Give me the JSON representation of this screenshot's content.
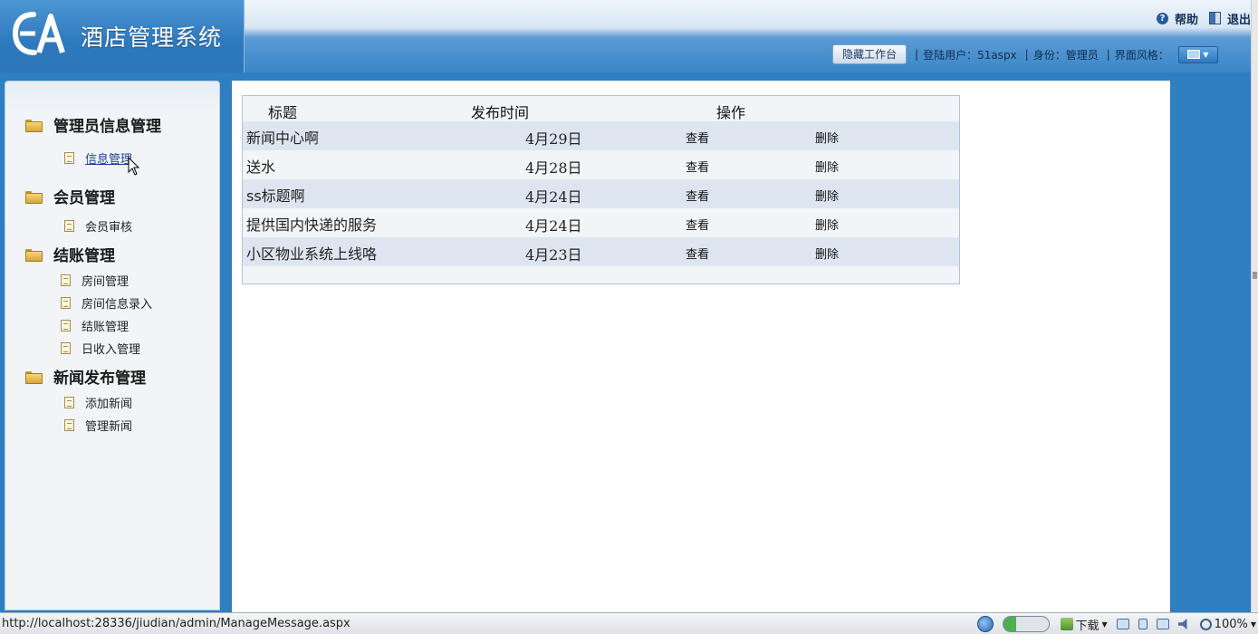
{
  "app": {
    "logo_text": "EA",
    "title": "酒店管理系统"
  },
  "header": {
    "help_label": "帮助",
    "logout_label": "退出",
    "hide_desktop_label": "隐藏工作台",
    "login_user": "登陆用户：51aspx",
    "identity": "身份：管理员",
    "ui_style": "界面风格：",
    "separator": "|"
  },
  "sidebar": {
    "groups": [
      {
        "label": "管理员信息管理",
        "items": [
          {
            "label": "信息管理",
            "active": true
          }
        ]
      },
      {
        "label": "会员管理",
        "items": [
          {
            "label": "会员审核"
          }
        ]
      },
      {
        "label": "结账管理",
        "items": [
          {
            "label": "房间管理"
          },
          {
            "label": "房间信息录入"
          },
          {
            "label": "结账管理"
          },
          {
            "label": "日收入管理"
          }
        ]
      },
      {
        "label": "新闻发布管理",
        "items": [
          {
            "label": "添加新闻"
          },
          {
            "label": "管理新闻"
          }
        ]
      }
    ]
  },
  "table": {
    "headers": {
      "title": "标题",
      "time": "发布时间",
      "action": "操作"
    },
    "rows": [
      {
        "title": "新闻中心啊",
        "date": "4月29日",
        "view": "查看",
        "delete": "删除"
      },
      {
        "title": "送水",
        "date": "4月28日",
        "view": "查看",
        "delete": "删除"
      },
      {
        "title": "ss标题啊",
        "date": "4月24日",
        "view": "查看",
        "delete": "删除"
      },
      {
        "title": "提供国内快递的服务",
        "date": "4月24日",
        "view": "查看",
        "delete": "删除"
      },
      {
        "title": "小区物业系统上线咯",
        "date": "4月23日",
        "view": "查看",
        "delete": "删除"
      }
    ]
  },
  "browser": {
    "status_url": "http://localhost:28336/jiudian/admin/ManageMessage.aspx",
    "download_label": "下载",
    "zoom": "100%"
  },
  "colors": {
    "header_blue": "#2d7fc1",
    "row_alt": "#dde6f0",
    "table_border": "#aac4de"
  }
}
